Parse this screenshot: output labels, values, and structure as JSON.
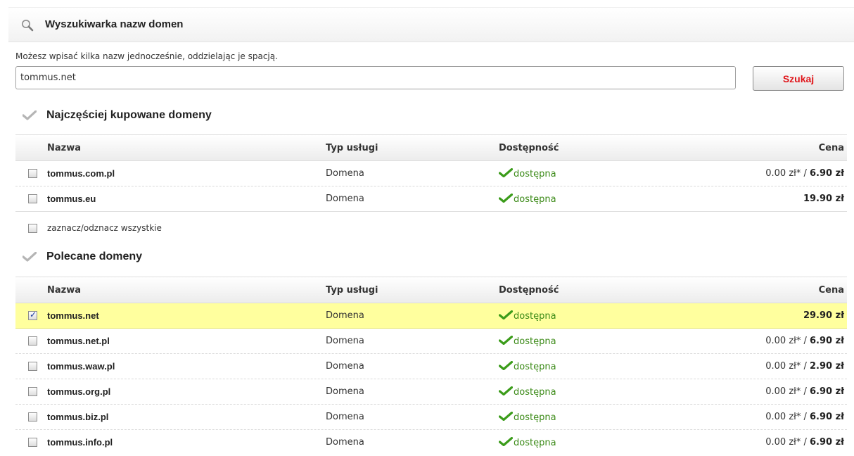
{
  "header": {
    "title": "Wyszukiwarka nazw domen",
    "icon": "search-icon"
  },
  "search": {
    "hint": "Możesz wpisać kilka nazw jednocześnie, oddzielając je spacją.",
    "value": "tommus.net",
    "button_label": "Szukaj"
  },
  "columns": {
    "name": "Nazwa",
    "type": "Typ usługi",
    "availability": "Dostępność",
    "price": "Cena"
  },
  "popular": {
    "title": "Najczęściej kupowane domeny",
    "rows": [
      {
        "name": "tommus.com.pl",
        "type": "Domena",
        "availability": "dostępna",
        "price_promo": "0.00 zł* / ",
        "price": "6.90 zł",
        "checked": false
      },
      {
        "name": "tommus.eu",
        "type": "Domena",
        "availability": "dostępna",
        "price_promo": "",
        "price": "19.90 zł",
        "checked": false
      }
    ],
    "toggle_all": "zaznacz/odznacz wszystkie"
  },
  "recommended": {
    "title": "Polecane domeny",
    "rows": [
      {
        "name": "tommus.net",
        "type": "Domena",
        "availability": "dostępna",
        "price_promo": "",
        "price": "29.90 zł",
        "checked": true
      },
      {
        "name": "tommus.net.pl",
        "type": "Domena",
        "availability": "dostępna",
        "price_promo": "0.00 zł* / ",
        "price": "6.90 zł",
        "checked": false
      },
      {
        "name": "tommus.waw.pl",
        "type": "Domena",
        "availability": "dostępna",
        "price_promo": "0.00 zł* / ",
        "price": "2.90 zł",
        "checked": false
      },
      {
        "name": "tommus.org.pl",
        "type": "Domena",
        "availability": "dostępna",
        "price_promo": "0.00 zł* / ",
        "price": "6.90 zł",
        "checked": false
      },
      {
        "name": "tommus.biz.pl",
        "type": "Domena",
        "availability": "dostępna",
        "price_promo": "0.00 zł* / ",
        "price": "6.90 zł",
        "checked": false
      },
      {
        "name": "tommus.info.pl",
        "type": "Domena",
        "availability": "dostępna",
        "price_promo": "0.00 zł* / ",
        "price": "6.90 zł",
        "checked": false
      }
    ]
  },
  "colors": {
    "available": "#3b8a17",
    "highlight": "#ffff9e",
    "button_text": "#e0161b"
  }
}
